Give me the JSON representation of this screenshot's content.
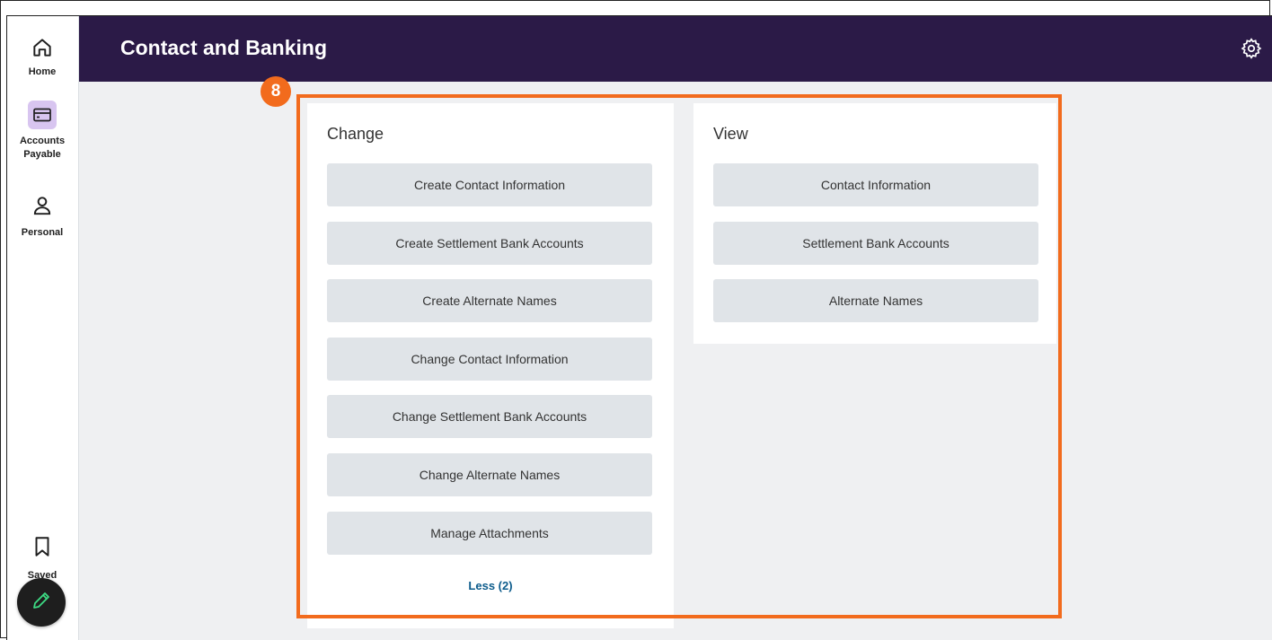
{
  "header": {
    "title": "Contact and Banking"
  },
  "rail": {
    "items": [
      {
        "label": "Home",
        "icon": "home-icon"
      },
      {
        "label": "Accounts Payable",
        "icon": "credit-card-icon"
      },
      {
        "label": "Personal",
        "icon": "person-icon"
      }
    ],
    "saved_label": "Saved",
    "fab_icon": "pencil-icon"
  },
  "change_card": {
    "title": "Change",
    "buttons": [
      "Create Contact Information",
      "Create Settlement Bank Accounts",
      "Create Alternate Names",
      "Change Contact Information",
      "Change Settlement Bank Accounts",
      "Change Alternate Names",
      "Manage Attachments"
    ],
    "less_link": "Less (2)"
  },
  "view_card": {
    "title": "View",
    "buttons": [
      "Contact Information",
      "Settlement Bank Accounts",
      "Alternate Names"
    ]
  },
  "annotation": {
    "badge": "8"
  },
  "colors": {
    "header_bg": "#2b1a47",
    "highlight": "#f26b1d",
    "active_rail": "#d8c5f0",
    "link": "#0d5c8c"
  }
}
